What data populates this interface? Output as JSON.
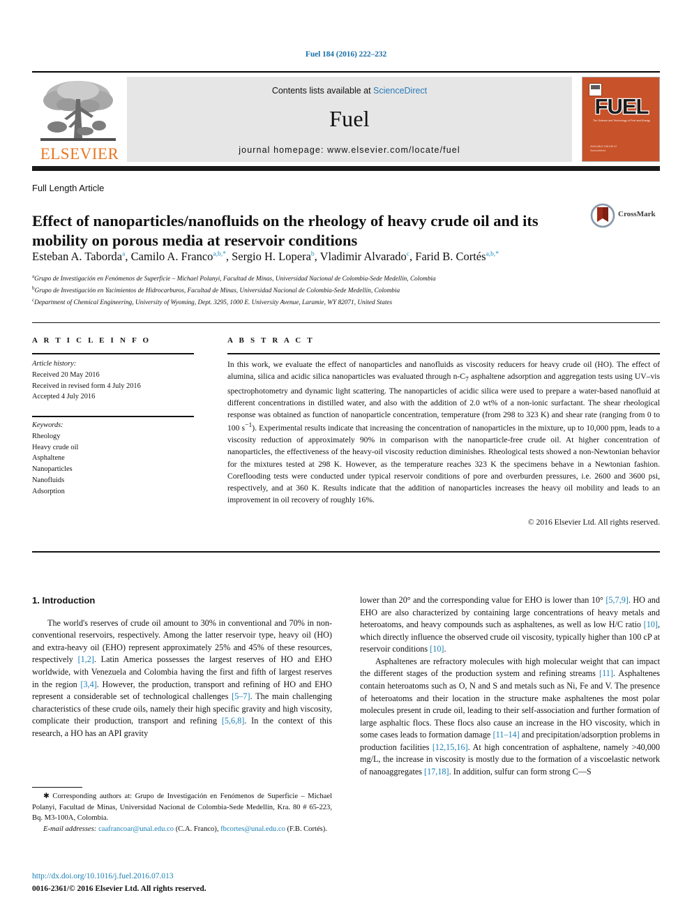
{
  "running_head": "Fuel 184 (2016) 222–232",
  "masthead": {
    "publisher_name": "ELSEVIER",
    "contents_prefix": "Contents lists available at ",
    "contents_link": "ScienceDirect",
    "journal_name": "Fuel",
    "homepage": "journal homepage: www.elsevier.com/locate/fuel",
    "cover": {
      "title": "FUEL",
      "subtitle": "The Science and Technology of Fuel and Energy",
      "bottom_line_1": "AVAILABLE ONLINE AT",
      "bottom_line_2": "ScienceDirect"
    }
  },
  "article": {
    "type": "Full Length Article",
    "title": "Effect of nanoparticles/nanofluids on the rheology of heavy crude oil and its mobility on porous media at reservoir conditions",
    "crossmark_label": "CrossMark",
    "authors": [
      {
        "name": "Esteban A. Taborda",
        "sup": "a",
        "sep": ", "
      },
      {
        "name": "Camilo A. Franco",
        "sup": "a,b,*",
        "sep": ", "
      },
      {
        "name": "Sergio H. Lopera",
        "sup": "b",
        "sep": ", "
      },
      {
        "name": "Vladimir Alvarado",
        "sup": "c",
        "sep": ", "
      },
      {
        "name": "Farid B. Cortés",
        "sup": "a,b,*",
        "sep": ""
      }
    ],
    "affiliations": [
      {
        "mark": "a",
        "text": "Grupo de Investigación en Fenómenos de Superficie – Michael Polanyi, Facultad de Minas, Universidad Nacional de Colombia-Sede Medellín, Colombia"
      },
      {
        "mark": "b",
        "text": "Grupo de Investigación en Yacimientos de Hidrocarburos, Facultad de Minas, Universidad Nacional de Colombia-Sede Medellín, Colombia"
      },
      {
        "mark": "c",
        "text": "Department of Chemical Engineering, University of Wyoming, Dept. 3295, 1000 E. University Avenue, Laramie, WY 82071, United States"
      }
    ]
  },
  "info": {
    "heading": "A R T I C L E  I N F O",
    "history_label": "Article history:",
    "history": [
      "Received 20 May 2016",
      "Received in revised form 4 July 2016",
      "Accepted 4 July 2016"
    ],
    "keywords_label": "Keywords:",
    "keywords": [
      "Rheology",
      "Heavy crude oil",
      "Asphaltene",
      "Nanoparticles",
      "Nanofluids",
      "Adsorption"
    ]
  },
  "abstract": {
    "heading": "A B S T R A C T",
    "text": "In this work, we evaluate the effect of nanoparticles and nanofluids as viscosity reducers for heavy crude oil (HO). The effect of alumina, silica and acidic silica nanoparticles was evaluated through n-C7 asphaltene adsorption and aggregation tests using UV–vis spectrophotometry and dynamic light scattering. The nanoparticles of acidic silica were used to prepare a water-based nanofluid at different concentrations in distilled water, and also with the addition of 2.0 wt% of a non-ionic surfactant. The shear rheological response was obtained as function of nanoparticle concentration, temperature (from 298 to 323 K) and shear rate (ranging from 0 to 100 s−1). Experimental results indicate that increasing the concentration of nanoparticles in the mixture, up to 10,000 ppm, leads to a viscosity reduction of approximately 90% in comparison with the nanoparticle-free crude oil. At higher concentration of nanoparticles, the effectiveness of the heavy-oil viscosity reduction diminishes. Rheological tests showed a non-Newtonian behavior for the mixtures tested at 298 K. However, as the temperature reaches 323 K the specimens behave in a Newtonian fashion. Coreflooding tests were conducted under typical reservoir conditions of pore and overburden pressures, i.e. 2600 and 3600 psi, respectively, and at 360 K. Results indicate that the addition of nanoparticles increases the heavy oil mobility and leads to an improvement in oil recovery of roughly 16%.",
    "copyright": "© 2016 Elsevier Ltd. All rights reserved."
  },
  "body": {
    "section_heading": "1. Introduction",
    "left_paragraph": "The world's reserves of crude oil amount to 30% in conventional and 70% in non-conventional reservoirs, respectively. Among the latter reservoir type, heavy oil (HO) and extra-heavy oil (EHO) represent approximately 25% and 45% of these resources, respectively [1,2]. Latin America possesses the largest reserves of HO and EHO worldwide, with Venezuela and Colombia having the first and fifth of largest reserves in the region [3,4]. However, the production, transport and refining of HO and EHO represent a considerable set of technological challenges [5–7]. The main challenging characteristics of these crude oils, namely their high specific gravity and high viscosity, complicate their production, transport and refining [5,6,8]. In the context of this research, a HO has an API gravity",
    "right_paragraph_1": "lower than 20° and the corresponding value for EHO is lower than 10° [5,7,9]. HO and EHO are also characterized by containing large concentrations of heavy metals and heteroatoms, and heavy compounds such as asphaltenes, as well as low H/C ratio [10], which directly influence the observed crude oil viscosity, typically higher than 100 cP at reservoir conditions [10].",
    "right_paragraph_2": "Asphaltenes are refractory molecules with high molecular weight that can impact the different stages of the production system and refining streams [11]. Asphaltenes contain heteroatoms such as O, N and S and metals such as Ni, Fe and V. The presence of heteroatoms and their location in the structure make asphaltenes the most polar molecules present in crude oil, leading to their self-association and further formation of large asphaltic flocs. These flocs also cause an increase in the HO viscosity, which in some cases leads to formation damage [11–14] and precipitation/adsorption problems in production facilities [12,15,16]. At high concentration of asphaltene, namely >40,000 mg/L, the increase in viscosity is mostly due to the formation of a viscoelastic network of nanoaggregates [17,18]. In addition, sulfur can form strong C—S"
  },
  "footnotes": {
    "corresponding": "Corresponding authors at: Grupo de Investigación en Fenómenos de Superficie – Michael Polanyi, Facultad de Minas, Universidad Nacional de Colombia-Sede Medellín, Kra. 80 # 65-223, Bq. M3-100A, Colombia.",
    "email_label": "E-mail addresses:",
    "email_1": "caafrancoar@unal.edu.co",
    "email_1_owner": "(C.A. Franco),",
    "email_2": "fbcortes@unal.edu.co",
    "email_2_owner": "(F.B. Cortés).",
    "doi": "http://dx.doi.org/10.1016/j.fuel.2016.07.013",
    "issn": "0016-2361/© 2016 Elsevier Ltd. All rights reserved."
  },
  "colors": {
    "link": "#1a7fb5",
    "elsevier_orange": "#E87722",
    "cover_orange": "#c8522a",
    "sciencedirect_blue": "#2a7ab9"
  }
}
